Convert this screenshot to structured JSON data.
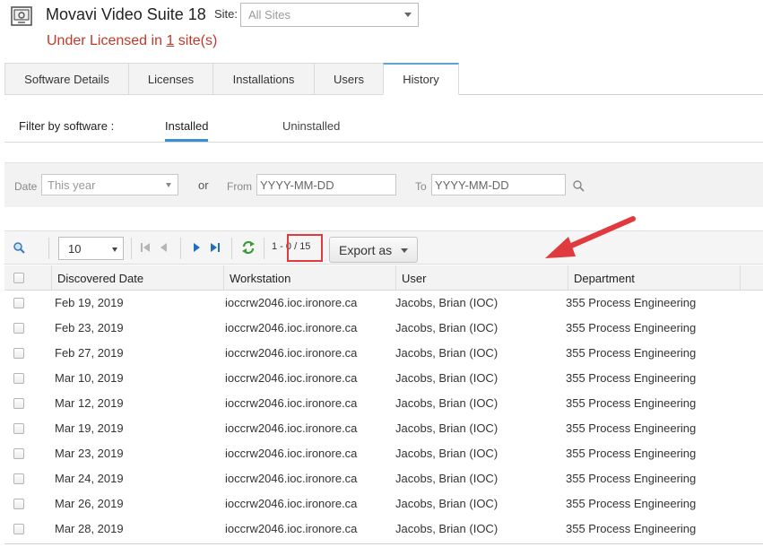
{
  "header": {
    "title": "Movavi Video Suite 18",
    "site_label": "Site:",
    "site_value": "All Sites",
    "license_prefix": "Under Licensed in ",
    "license_count": "1",
    "license_suffix": " site(s)"
  },
  "tabs": [
    {
      "label": "Software Details",
      "active": false
    },
    {
      "label": "Licenses",
      "active": false
    },
    {
      "label": "Installations",
      "active": false
    },
    {
      "label": "Users",
      "active": false
    },
    {
      "label": "History",
      "active": true
    }
  ],
  "filter": {
    "label": "Filter by software :",
    "options": [
      {
        "label": "Installed",
        "active": true
      },
      {
        "label": "Uninstalled",
        "active": false
      }
    ]
  },
  "date_filter": {
    "date_label": "Date",
    "period_value": "This year",
    "or_label": "or",
    "from_label": "From",
    "from_placeholder": "YYYY-MM-DD",
    "to_label": "To",
    "to_placeholder": "YYYY-MM-DD"
  },
  "toolbar": {
    "page_size": "10",
    "range_prefix": "1 - ",
    "range_value": "0 / 15",
    "export_label": "Export as"
  },
  "table": {
    "columns": [
      "Discovered Date",
      "Workstation",
      "User",
      "Department"
    ],
    "rows": [
      [
        "Feb 19, 2019",
        "ioccrw2046.ioc.ironore.ca",
        "Jacobs, Brian (IOC)",
        "355 Process Engineering"
      ],
      [
        "Feb 23, 2019",
        "ioccrw2046.ioc.ironore.ca",
        "Jacobs, Brian (IOC)",
        "355 Process Engineering"
      ],
      [
        "Feb 27, 2019",
        "ioccrw2046.ioc.ironore.ca",
        "Jacobs, Brian (IOC)",
        "355 Process Engineering"
      ],
      [
        "Mar 10, 2019",
        "ioccrw2046.ioc.ironore.ca",
        "Jacobs, Brian (IOC)",
        "355 Process Engineering"
      ],
      [
        "Mar 12, 2019",
        "ioccrw2046.ioc.ironore.ca",
        "Jacobs, Brian (IOC)",
        "355 Process Engineering"
      ],
      [
        "Mar 19, 2019",
        "ioccrw2046.ioc.ironore.ca",
        "Jacobs, Brian (IOC)",
        "355 Process Engineering"
      ],
      [
        "Mar 23, 2019",
        "ioccrw2046.ioc.ironore.ca",
        "Jacobs, Brian (IOC)",
        "355 Process Engineering"
      ],
      [
        "Mar 24, 2019",
        "ioccrw2046.ioc.ironore.ca",
        "Jacobs, Brian (IOC)",
        "355 Process Engineering"
      ],
      [
        "Mar 26, 2019",
        "ioccrw2046.ioc.ironore.ca",
        "Jacobs, Brian (IOC)",
        "355 Process Engineering"
      ],
      [
        "Mar 28, 2019",
        "ioccrw2046.ioc.ironore.ca",
        "Jacobs, Brian (IOC)",
        "355 Process Engineering"
      ]
    ]
  },
  "colors": {
    "warning": "#c0392b",
    "tab_accent": "#5aa6d8",
    "annotation_red": "#e0393e",
    "nav_blue": "#1f6fc4",
    "refresh_green": "#3a9a3a"
  },
  "icons": [
    "app-monitor-icon",
    "search-icon",
    "first-page-icon",
    "prev-page-icon",
    "next-page-icon",
    "last-page-icon",
    "refresh-icon",
    "annotation-arrow"
  ]
}
